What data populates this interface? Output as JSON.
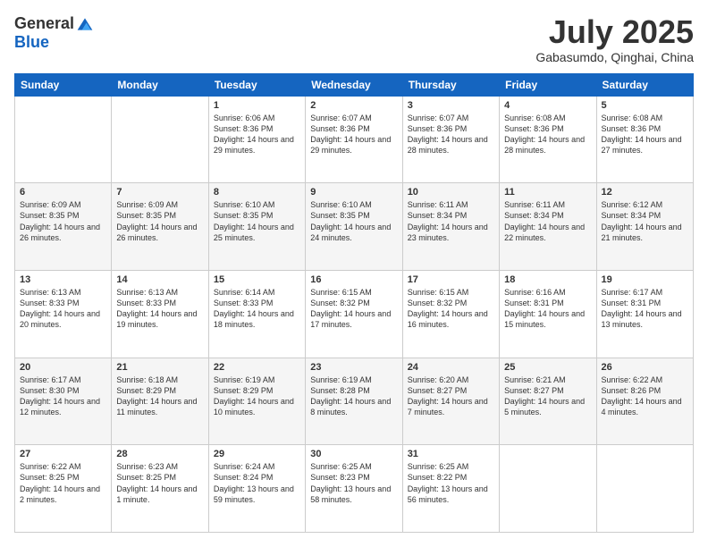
{
  "logo": {
    "general": "General",
    "blue": "Blue"
  },
  "title": "July 2025",
  "subtitle": "Gabasumdo, Qinghai, China",
  "weekdays": [
    "Sunday",
    "Monday",
    "Tuesday",
    "Wednesday",
    "Thursday",
    "Friday",
    "Saturday"
  ],
  "weeks": [
    [
      {
        "day": "",
        "info": ""
      },
      {
        "day": "",
        "info": ""
      },
      {
        "day": "1",
        "info": "Sunrise: 6:06 AM\nSunset: 8:36 PM\nDaylight: 14 hours and 29 minutes."
      },
      {
        "day": "2",
        "info": "Sunrise: 6:07 AM\nSunset: 8:36 PM\nDaylight: 14 hours and 29 minutes."
      },
      {
        "day": "3",
        "info": "Sunrise: 6:07 AM\nSunset: 8:36 PM\nDaylight: 14 hours and 28 minutes."
      },
      {
        "day": "4",
        "info": "Sunrise: 6:08 AM\nSunset: 8:36 PM\nDaylight: 14 hours and 28 minutes."
      },
      {
        "day": "5",
        "info": "Sunrise: 6:08 AM\nSunset: 8:36 PM\nDaylight: 14 hours and 27 minutes."
      }
    ],
    [
      {
        "day": "6",
        "info": "Sunrise: 6:09 AM\nSunset: 8:35 PM\nDaylight: 14 hours and 26 minutes."
      },
      {
        "day": "7",
        "info": "Sunrise: 6:09 AM\nSunset: 8:35 PM\nDaylight: 14 hours and 26 minutes."
      },
      {
        "day": "8",
        "info": "Sunrise: 6:10 AM\nSunset: 8:35 PM\nDaylight: 14 hours and 25 minutes."
      },
      {
        "day": "9",
        "info": "Sunrise: 6:10 AM\nSunset: 8:35 PM\nDaylight: 14 hours and 24 minutes."
      },
      {
        "day": "10",
        "info": "Sunrise: 6:11 AM\nSunset: 8:34 PM\nDaylight: 14 hours and 23 minutes."
      },
      {
        "day": "11",
        "info": "Sunrise: 6:11 AM\nSunset: 8:34 PM\nDaylight: 14 hours and 22 minutes."
      },
      {
        "day": "12",
        "info": "Sunrise: 6:12 AM\nSunset: 8:34 PM\nDaylight: 14 hours and 21 minutes."
      }
    ],
    [
      {
        "day": "13",
        "info": "Sunrise: 6:13 AM\nSunset: 8:33 PM\nDaylight: 14 hours and 20 minutes."
      },
      {
        "day": "14",
        "info": "Sunrise: 6:13 AM\nSunset: 8:33 PM\nDaylight: 14 hours and 19 minutes."
      },
      {
        "day": "15",
        "info": "Sunrise: 6:14 AM\nSunset: 8:33 PM\nDaylight: 14 hours and 18 minutes."
      },
      {
        "day": "16",
        "info": "Sunrise: 6:15 AM\nSunset: 8:32 PM\nDaylight: 14 hours and 17 minutes."
      },
      {
        "day": "17",
        "info": "Sunrise: 6:15 AM\nSunset: 8:32 PM\nDaylight: 14 hours and 16 minutes."
      },
      {
        "day": "18",
        "info": "Sunrise: 6:16 AM\nSunset: 8:31 PM\nDaylight: 14 hours and 15 minutes."
      },
      {
        "day": "19",
        "info": "Sunrise: 6:17 AM\nSunset: 8:31 PM\nDaylight: 14 hours and 13 minutes."
      }
    ],
    [
      {
        "day": "20",
        "info": "Sunrise: 6:17 AM\nSunset: 8:30 PM\nDaylight: 14 hours and 12 minutes."
      },
      {
        "day": "21",
        "info": "Sunrise: 6:18 AM\nSunset: 8:29 PM\nDaylight: 14 hours and 11 minutes."
      },
      {
        "day": "22",
        "info": "Sunrise: 6:19 AM\nSunset: 8:29 PM\nDaylight: 14 hours and 10 minutes."
      },
      {
        "day": "23",
        "info": "Sunrise: 6:19 AM\nSunset: 8:28 PM\nDaylight: 14 hours and 8 minutes."
      },
      {
        "day": "24",
        "info": "Sunrise: 6:20 AM\nSunset: 8:27 PM\nDaylight: 14 hours and 7 minutes."
      },
      {
        "day": "25",
        "info": "Sunrise: 6:21 AM\nSunset: 8:27 PM\nDaylight: 14 hours and 5 minutes."
      },
      {
        "day": "26",
        "info": "Sunrise: 6:22 AM\nSunset: 8:26 PM\nDaylight: 14 hours and 4 minutes."
      }
    ],
    [
      {
        "day": "27",
        "info": "Sunrise: 6:22 AM\nSunset: 8:25 PM\nDaylight: 14 hours and 2 minutes."
      },
      {
        "day": "28",
        "info": "Sunrise: 6:23 AM\nSunset: 8:25 PM\nDaylight: 14 hours and 1 minute."
      },
      {
        "day": "29",
        "info": "Sunrise: 6:24 AM\nSunset: 8:24 PM\nDaylight: 13 hours and 59 minutes."
      },
      {
        "day": "30",
        "info": "Sunrise: 6:25 AM\nSunset: 8:23 PM\nDaylight: 13 hours and 58 minutes."
      },
      {
        "day": "31",
        "info": "Sunrise: 6:25 AM\nSunset: 8:22 PM\nDaylight: 13 hours and 56 minutes."
      },
      {
        "day": "",
        "info": ""
      },
      {
        "day": "",
        "info": ""
      }
    ]
  ]
}
